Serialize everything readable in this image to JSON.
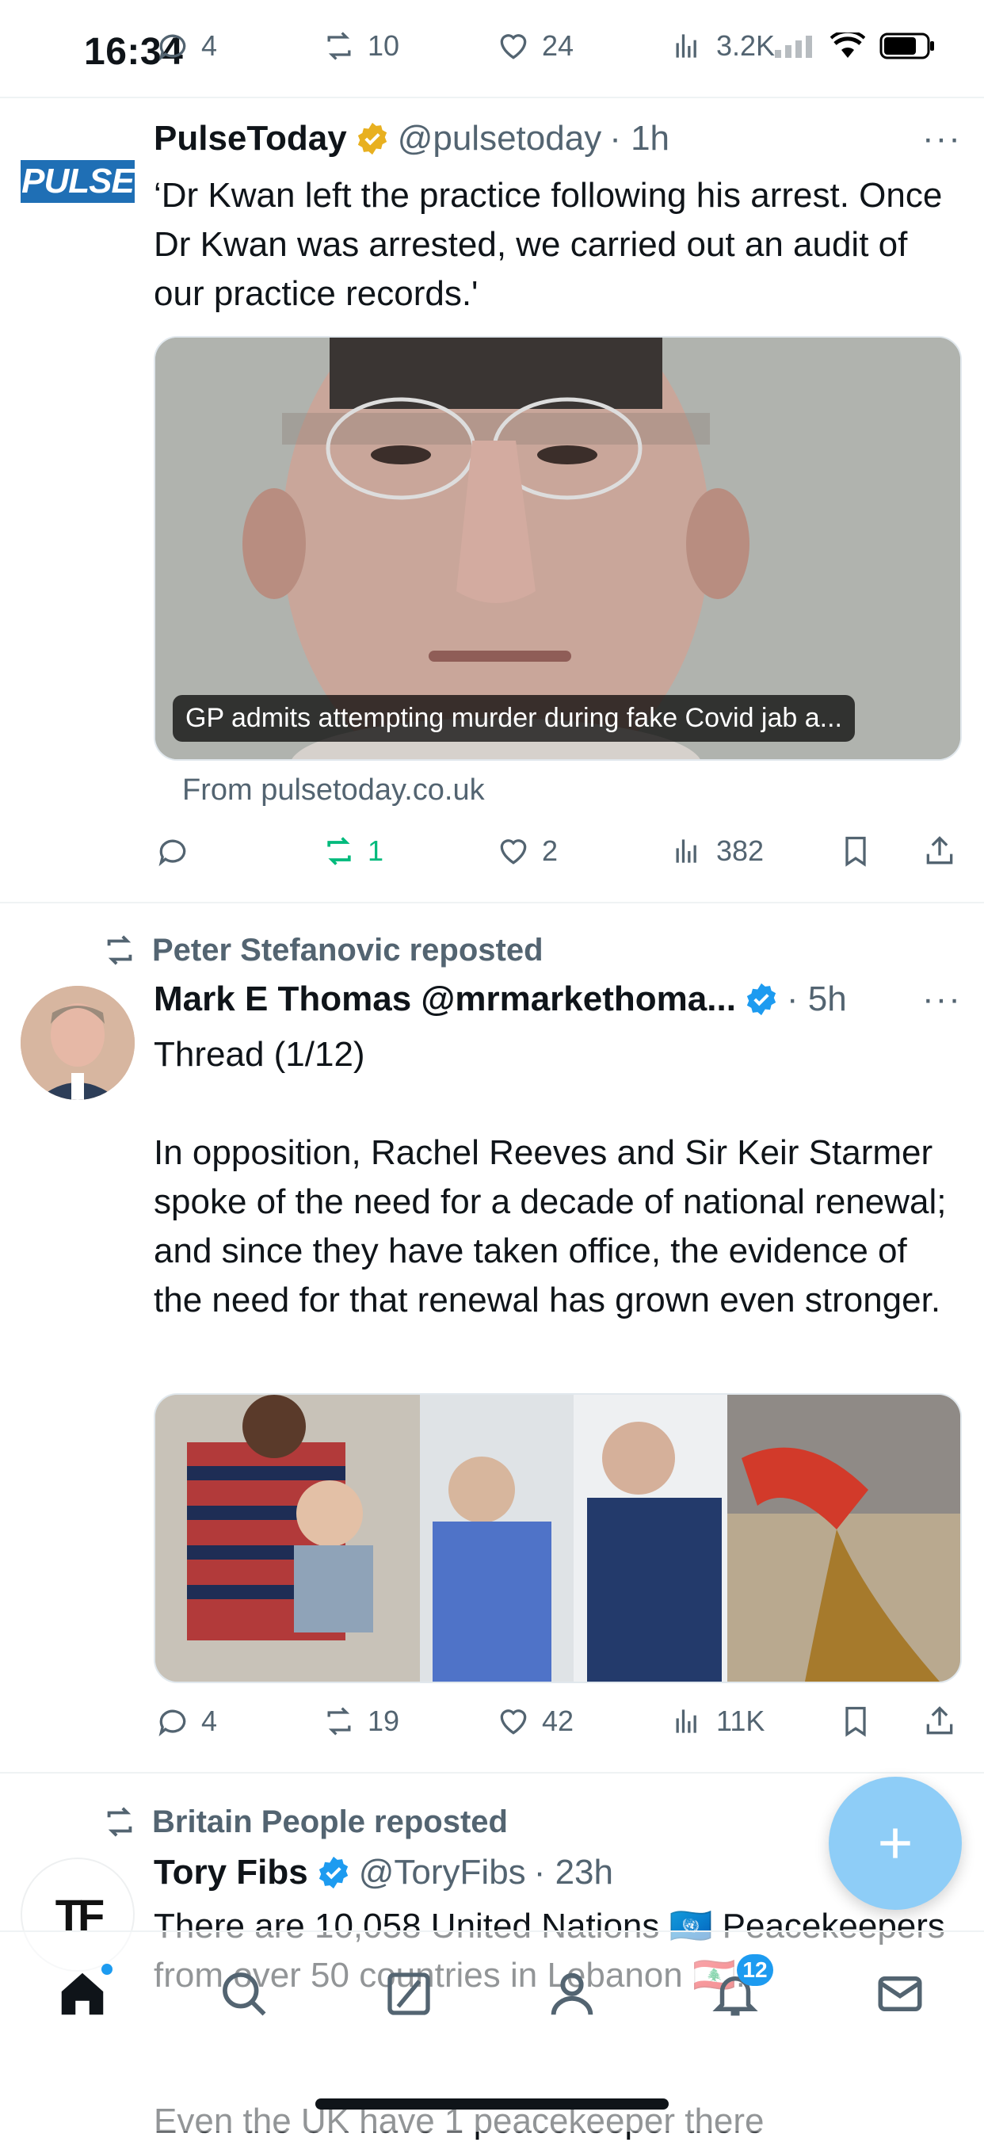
{
  "status_bar": {
    "time": "16:34"
  },
  "top_tweet_actions": {
    "replies": "4",
    "reposts": "10",
    "likes": "24",
    "views": "3.2K"
  },
  "tweet1": {
    "display_name": "PulseToday",
    "handle": "@pulsetoday",
    "time": "· 1h",
    "avatar_text": "PULSE",
    "text": "‘Dr Kwan left the practice following his arrest. Once Dr Kwan was arrested, we carried out an audit of our practice records.'",
    "card_caption": "GP admits attempting murder during fake Covid jab a...",
    "card_source": "From pulsetoday.co.uk",
    "actions": {
      "replies": "",
      "reposts": "1",
      "likes": "2",
      "views": "382"
    }
  },
  "tweet2": {
    "repost_label": "Peter Stefanovic reposted",
    "display_name": "Mark E Thomas @mrmarkethoma...",
    "time": "· 5h",
    "text_line1": "Thread (1/12)",
    "text_body": "In opposition, Rachel Reeves and Sir Keir Starmer spoke of the need for a decade of national renewal; and since they have taken office, the evidence of the need for that renewal has grown even stronger.",
    "actions": {
      "replies": "4",
      "reposts": "19",
      "likes": "42",
      "views": "11K"
    }
  },
  "tweet3": {
    "repost_label": "Britain People reposted",
    "display_name": "Tory Fibs",
    "handle": "@ToryFibs",
    "time": "· 23h",
    "avatar_text": "TF",
    "text": "There are 10,058 United Nations 🇺🇳 Peacekeepers from over 50 countries in Lebanon 🇱🇧.",
    "text2": "Even the UK have 1 peacekeeper there"
  },
  "tabbar": {
    "notifications_badge": "12"
  },
  "colors": {
    "accent": "#1d9bf0",
    "verified_gold": "#e8b020",
    "repost_green": "#00ba7c",
    "muted": "#536471"
  }
}
